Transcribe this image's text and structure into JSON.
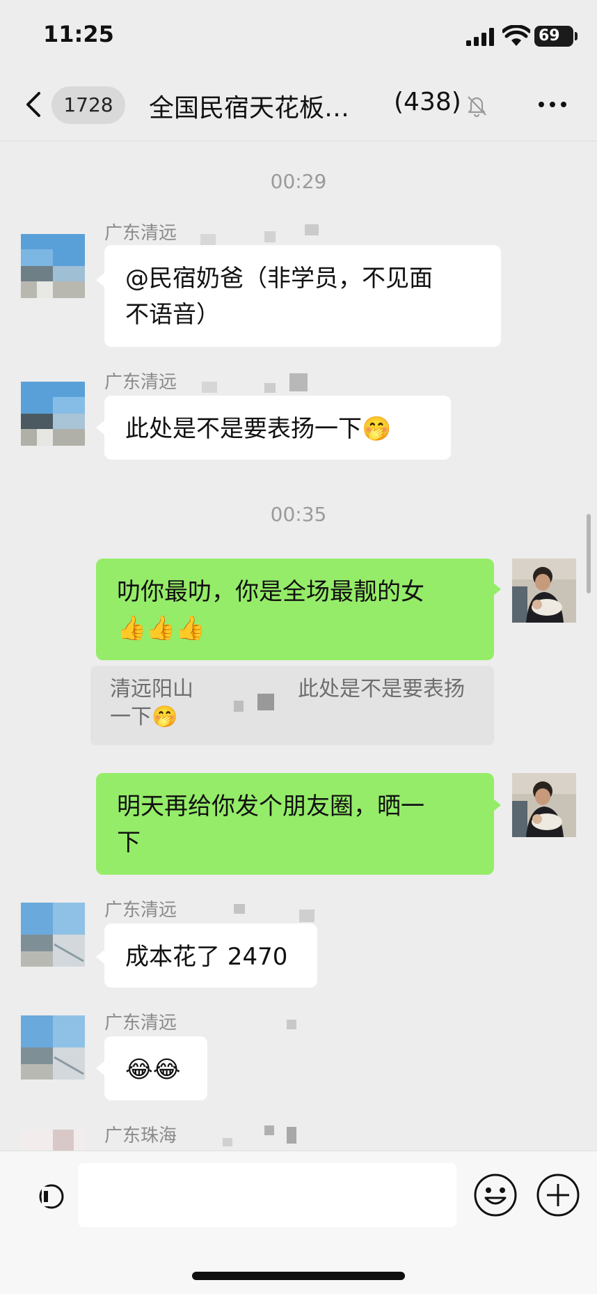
{
  "status_bar": {
    "time": "11:25",
    "battery": "69"
  },
  "nav": {
    "unread_count": "1728",
    "title": "全国民宿天花板…",
    "member_count": "(438)"
  },
  "messages": [
    {
      "type": "timestamp",
      "text": "00:29"
    },
    {
      "type": "received",
      "sender": "广东清远",
      "text_line1": "@民宿奶爸（非学员，不见面",
      "text_line2": "不语音）"
    },
    {
      "type": "received",
      "sender": "广东清远",
      "text": "此处是不是要表扬一下",
      "emoji": "🤭"
    },
    {
      "type": "timestamp",
      "text": "00:35"
    },
    {
      "type": "sent",
      "text_line1": "叻你最叻，你是全场最靓的女",
      "emoji": "👍👍👍"
    },
    {
      "type": "quote",
      "quoted_sender": "清远阳山",
      "quoted_text_line1": "此处是不是要表扬",
      "quoted_text_line2": "一下",
      "emoji": "🤭"
    },
    {
      "type": "sent",
      "text_line1": "明天再给你发个朋友圈，晒一",
      "text_line2": "下"
    },
    {
      "type": "received",
      "sender": "广东清远",
      "text": "成本花了 2470"
    },
    {
      "type": "received",
      "sender": "广东清远",
      "emoji": "😂😂"
    },
    {
      "type": "received",
      "sender": "广东珠海"
    }
  ],
  "input": {
    "placeholder": ""
  },
  "colors": {
    "background": "#ededed",
    "sent_bubble": "#95ec69",
    "received_bubble": "#ffffff"
  }
}
